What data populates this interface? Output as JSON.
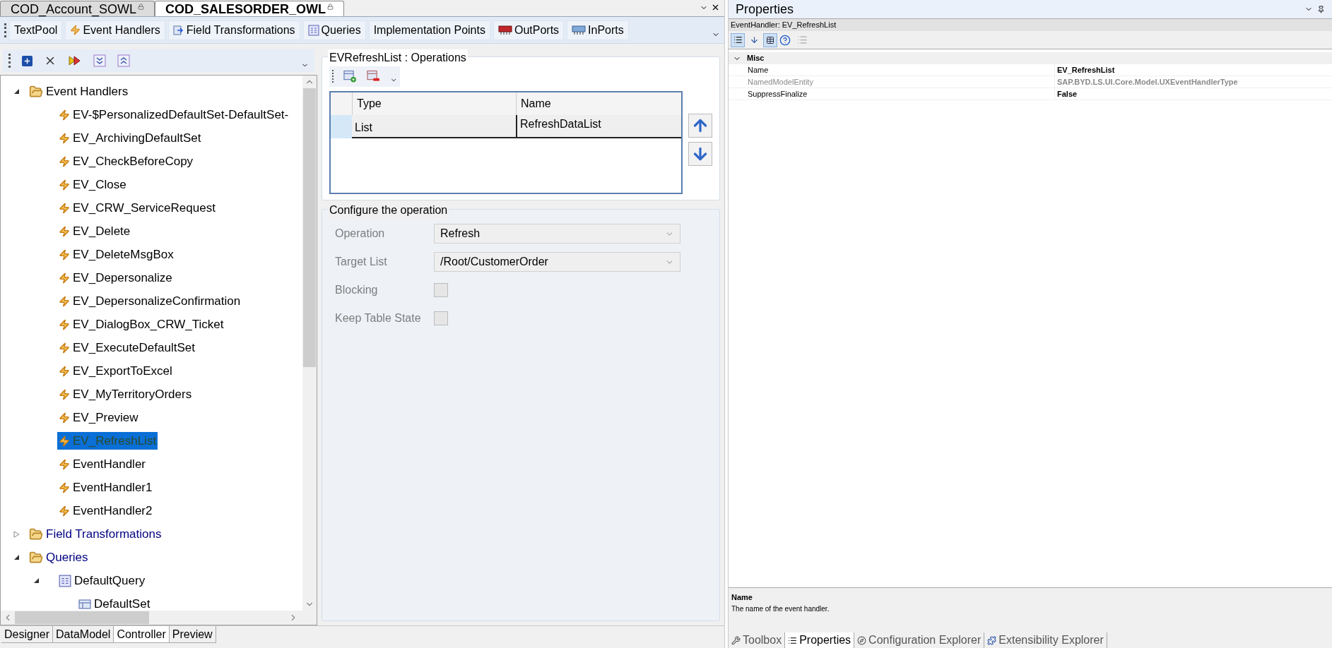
{
  "document_tabs": [
    {
      "label": "COD_Account_SOWL",
      "selected": false,
      "locked": true
    },
    {
      "label": "COD_SALESORDER_OWL",
      "selected": true,
      "locked": true
    }
  ],
  "toolbar": [
    {
      "label": "TextPool",
      "kind": "textpool"
    },
    {
      "label": "Event Handlers",
      "kind": "handlers"
    },
    {
      "label": "Field Transformations",
      "kind": "transformations"
    },
    {
      "label": "Queries",
      "kind": "queries"
    },
    {
      "label": "Implementation Points",
      "kind": "points"
    },
    {
      "label": "OutPorts",
      "kind": "outports"
    },
    {
      "label": "InPorts",
      "kind": "inports"
    }
  ],
  "tree": [
    {
      "label": "Event Handlers",
      "kind": "folder",
      "color": "#000000",
      "expanded": true,
      "selected": false,
      "children": [
        {
          "label": "EV-$PersonalizedDefaultSet-DefaultSet-",
          "kind": "handler",
          "selected": false
        },
        {
          "label": "EV_ArchivingDefaultSet",
          "kind": "handler",
          "selected": false
        },
        {
          "label": "EV_CheckBeforeCopy",
          "kind": "handler",
          "selected": false
        },
        {
          "label": "EV_Close",
          "kind": "handler",
          "selected": false
        },
        {
          "label": "EV_CRW_ServiceRequest",
          "kind": "handler",
          "selected": false
        },
        {
          "label": "EV_Delete",
          "kind": "handler",
          "selected": false
        },
        {
          "label": "EV_DeleteMsgBox",
          "kind": "handler",
          "selected": false
        },
        {
          "label": "EV_Depersonalize",
          "kind": "handler",
          "selected": false
        },
        {
          "label": "EV_DepersonalizeConfirmation",
          "kind": "handler",
          "selected": false
        },
        {
          "label": "EV_DialogBox_CRW_Ticket",
          "kind": "handler",
          "selected": false
        },
        {
          "label": "EV_ExecuteDefaultSet",
          "kind": "handler",
          "selected": false
        },
        {
          "label": "EV_ExportToExcel",
          "kind": "handler",
          "selected": false
        },
        {
          "label": "EV_MyTerritoryOrders",
          "kind": "handler",
          "selected": false
        },
        {
          "label": "EV_Preview",
          "kind": "handler",
          "selected": false
        },
        {
          "label": "EV_RefreshList",
          "kind": "handler",
          "selected": true
        },
        {
          "label": "EventHandler",
          "kind": "handler",
          "selected": false
        },
        {
          "label": "EventHandler1",
          "kind": "handler",
          "selected": false
        },
        {
          "label": "EventHandler2",
          "kind": "handler",
          "selected": false
        }
      ]
    },
    {
      "label": "Field Transformations",
      "kind": "folder",
      "color": "#000080",
      "expanded": false,
      "selected": false
    },
    {
      "label": "Queries",
      "kind": "folder",
      "color": "#000080",
      "expanded": true,
      "selected": false,
      "children": [
        {
          "label": "DefaultQuery",
          "kind": "query",
          "expanded": true,
          "selected": false,
          "children": [
            {
              "label": "DefaultSet",
              "kind": "set",
              "selected": false
            }
          ]
        }
      ]
    }
  ],
  "operations": {
    "title": "EVRefreshList : Operations",
    "columns": [
      "Type",
      "Name"
    ],
    "rows": [
      {
        "type": "List",
        "name": "RefreshDataList",
        "selected": true
      }
    ]
  },
  "configure": {
    "title": "Configure the operation",
    "disabled": true,
    "fields": [
      {
        "label": "Operation",
        "kind": "dropdown",
        "value": "Refresh"
      },
      {
        "label": "Target List",
        "kind": "dropdown",
        "value": "/Root/CustomerOrder"
      },
      {
        "label": "Blocking",
        "kind": "checkbox",
        "checked": false
      },
      {
        "label": "Keep Table State",
        "kind": "checkbox",
        "checked": false
      }
    ]
  },
  "bottom_tabs": [
    {
      "label": "Designer",
      "selected": false
    },
    {
      "label": "DataModel",
      "selected": false
    },
    {
      "label": "Controller",
      "selected": true
    },
    {
      "label": "Preview",
      "selected": false
    }
  ],
  "properties": {
    "title": "Properties",
    "object": "EventHandler: EV_RefreshList",
    "category": {
      "label": "Misc",
      "expanded": true
    },
    "rows": [
      {
        "name": "Name",
        "value": "EV_RefreshList",
        "disabled": false
      },
      {
        "name": "NamedModelEntity",
        "value": "SAP.BYD.LS.UI.Core.Model.UXEventHandlerType",
        "disabled": true
      },
      {
        "name": "SuppressFinalize",
        "value": "False",
        "disabled": false
      }
    ],
    "description_title": "Name",
    "description": "The name of the event handler.",
    "tabs": [
      {
        "label": "Toolbox",
        "selected": false
      },
      {
        "label": "Properties",
        "selected": true
      },
      {
        "label": "Configuration Explorer",
        "selected": false
      },
      {
        "label": "Extensibility Explorer",
        "selected": false
      }
    ]
  }
}
